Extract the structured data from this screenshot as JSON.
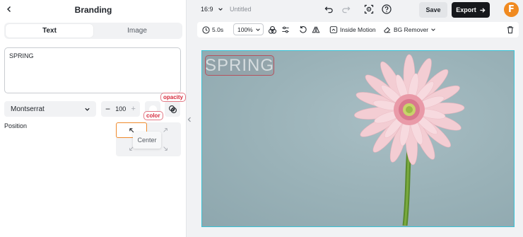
{
  "panel": {
    "title": "Branding",
    "tabs": [
      "Text",
      "Image"
    ],
    "text_value": "SPRING",
    "font_name": "Montserrat",
    "font_size": "100",
    "color_tag": "color",
    "opacity_tag": "opacity",
    "position_label": "Position",
    "position_center": "Center"
  },
  "topbar": {
    "ratio": "16:9",
    "doc_title": "Untitled",
    "save_label": "Save",
    "export_label": "Export",
    "logo_letter": "F"
  },
  "toolbar": {
    "duration": "5.0s",
    "zoom": "100%",
    "inside_motion": "Inside Motion",
    "bg_remover": "BG Remover"
  },
  "canvas": {
    "overlay_text": "SPRING"
  },
  "colors": {
    "accent_orange": "#ef8a2b",
    "canvas_border": "#39c3d7",
    "annotation_red": "#d6283a",
    "export_bg": "#16181c",
    "logo_bg": "#f08a20"
  }
}
